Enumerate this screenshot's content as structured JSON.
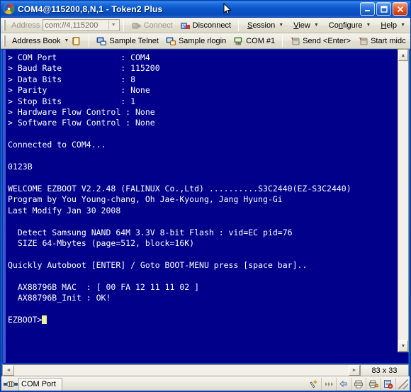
{
  "window": {
    "title": "COM4@115200,8,N,1 - Token2 Plus",
    "app_icon": "token2-app-icon",
    "minimize_label": "_",
    "maximize_label": "□",
    "close_label": "✕",
    "accent_titlebar_color": "#0b55c8"
  },
  "toolbar1": {
    "address_label": "Address",
    "address_value": "com://4,115200",
    "address_placeholder": "com://",
    "connect_label": "Connect",
    "connect_enabled": false,
    "disconnect_label": "Disconnect",
    "disconnect_enabled": true,
    "menus": [
      {
        "label": "Session",
        "accel": "S"
      },
      {
        "label": "View",
        "accel": "V"
      },
      {
        "label": "Configure",
        "accel": "n"
      },
      {
        "label": "Help",
        "accel": "H"
      }
    ]
  },
  "toolbar2": {
    "address_book_label": "Address Book",
    "buttons": [
      {
        "label": "Sample Telnet",
        "icon": "telnet-session-icon"
      },
      {
        "label": "Sample rlogin",
        "icon": "rlogin-session-icon"
      },
      {
        "label": "COM #1",
        "icon": "serial-session-icon"
      },
      {
        "label": "Send <Enter>",
        "icon": "send-macro-icon"
      },
      {
        "label": "Start midc",
        "icon": "start-macro-icon"
      }
    ],
    "overflow_label": "»"
  },
  "terminal": {
    "background_color": "#00008b",
    "text_color": "#ffffff",
    "cursor_color": "#f2f29a",
    "prompt": "EZBOOT>",
    "lines": [
      "> COM Port             : COM4",
      "> Baud Rate            : 115200",
      "> Data Bits            : 8",
      "> Parity               : None",
      "> Stop Bits            : 1",
      "> Hardware Flow Control : None",
      "> Software Flow Control : None",
      "",
      "Connected to COM4...",
      "",
      "0123B",
      "",
      "WELCOME EZBOOT V2.2.48 (FALINUX Co.,Ltd) ..........S3C2440(EZ-S3C2440)",
      "Program by You Young-chang, Oh Jae-Kyoung, Jang Hyung-Gi",
      "Last Modify Jan 30 2008",
      "",
      "  Detect Samsung NAND 64M 3.3V 8-bit Flash : vid=EC pid=76",
      "  SIZE 64-Mbytes (page=512, block=16K)",
      "",
      "Quickly Autoboot [ENTER] / Goto BOOT-MENU press [space bar]..",
      "",
      "  AX88796B MAC  : [ 00 FA 12 11 11 02 ]",
      "  AX88796B_Init : OK!",
      ""
    ]
  },
  "scrollbars": {
    "v_up_arrow": "▲",
    "v_down_arrow": "▼",
    "h_left_arrow": "◄",
    "h_right_arrow": "►",
    "size_indicator": "83 x 33"
  },
  "statusbar": {
    "tab_label": "COM Port",
    "tab_icon": "serial-port-icon",
    "icons": [
      "highlight-icon",
      "fast-forward-icon",
      "file-transfer-icon",
      "print-icon",
      "print-lock-icon",
      "log-capture-icon"
    ]
  }
}
